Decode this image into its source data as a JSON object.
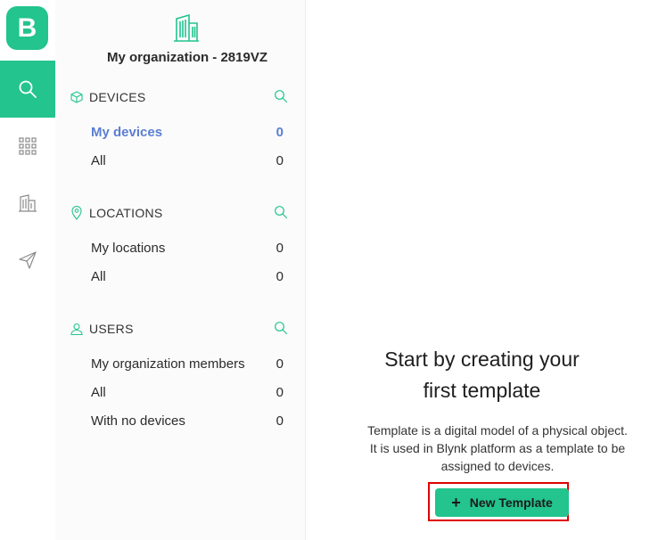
{
  "app": {
    "logo_letter": "B"
  },
  "rail": {
    "items": [
      {
        "icon": "search-icon",
        "active": true
      },
      {
        "icon": "apps-grid-icon",
        "active": false
      },
      {
        "icon": "building-icon",
        "active": false
      },
      {
        "icon": "send-icon",
        "active": false
      }
    ]
  },
  "sidebar": {
    "org_title": "My organization - 2819VZ",
    "sections": [
      {
        "label": "DEVICES",
        "rows": [
          {
            "label": "My devices",
            "count": "0"
          },
          {
            "label": "All",
            "count": "0"
          }
        ]
      },
      {
        "label": "LOCATIONS",
        "rows": [
          {
            "label": "My locations",
            "count": "0"
          },
          {
            "label": "All",
            "count": "0"
          }
        ]
      },
      {
        "label": "USERS",
        "rows": [
          {
            "label": "My organization members",
            "count": "0"
          },
          {
            "label": "All",
            "count": "0"
          },
          {
            "label": "With no devices",
            "count": "0"
          }
        ]
      }
    ]
  },
  "main": {
    "headline_line1": "Start by creating your",
    "headline_line2": "first template",
    "desc_line1": "Template is a digital model of a physical object.",
    "desc_line2": "It is used in Blynk platform as a template to be",
    "desc_line3": "assigned to devices.",
    "button_label": "New Template"
  },
  "colors": {
    "accent": "#23c48e",
    "selected": "#5b7fd2",
    "highlight_frame": "#e00000"
  }
}
